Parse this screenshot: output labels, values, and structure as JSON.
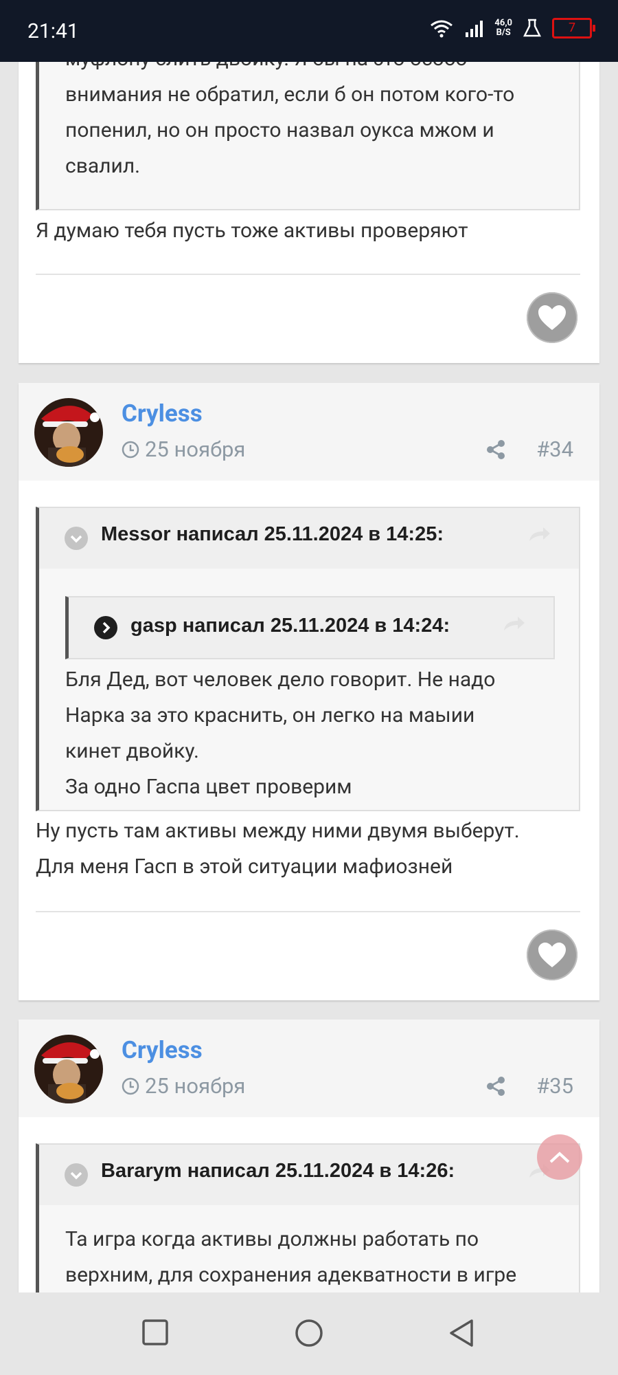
{
  "status_bar": {
    "time": "21:41",
    "net_speed_top": "46,0",
    "net_speed_bottom": "B/S",
    "battery": "7"
  },
  "posts": [
    {
      "quote_text": [
        "муфлону слить двойку. Я бы на это особо",
        "внимания не обратил, если б он потом кого-то",
        "попенил, но он просто назвал оукса мжом и",
        "свалил."
      ],
      "body": [
        "Я думаю тебя пусть тоже активы проверяют"
      ]
    },
    {
      "author": "Cryless",
      "date": "25 ноября",
      "number": "#34",
      "quote_title": "Messor написал 25.11.2024 в 14:25:",
      "nested_title": "gasp написал 25.11.2024 в 14:24:",
      "quote_text": [
        "Бля Дед, вот человек дело говорит. Не надо",
        "Нарка за это краснить, он легко на маыии",
        "кинет двойку.",
        "За одно Гаспа цвет проверим"
      ],
      "body": [
        "Ну пусть там активы между ними двумя выберут.",
        "Для меня Гасп в этой ситуации мафиозней"
      ]
    },
    {
      "author": "Cryless",
      "date": "25 ноября",
      "number": "#35",
      "quote_title": "Bararym написал 25.11.2024 в 14:26:",
      "quote_text": [
        "Та игра когда активы должны работать по",
        "верхним, для сохранения адекватности в игре"
      ]
    }
  ],
  "colors": {
    "author": "#4c8fe2",
    "meta": "#8d99a3",
    "status_bar_bg": "#111827",
    "like": "#9e9e9e"
  },
  "icons": [
    "wifi-icon",
    "signal-icon",
    "flask-icon",
    "battery-icon",
    "clock-icon",
    "share-icon",
    "reply-arrow-icon",
    "chevron-down-icon",
    "chevron-right-icon",
    "heart-icon",
    "square-nav-icon",
    "circle-nav-icon",
    "back-nav-icon"
  ]
}
